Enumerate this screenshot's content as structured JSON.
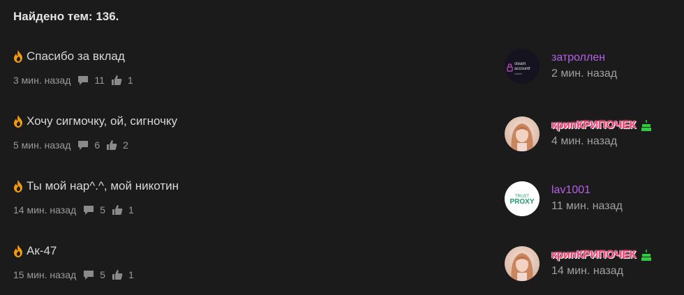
{
  "header": {
    "found_text": "Найдено тем: 136."
  },
  "threads": [
    {
      "title": "Спасибо за вклад",
      "time": "3 мин. назад",
      "replies": "11",
      "likes": "1",
      "last_user": "затроллен",
      "last_time": "2 мин. назад",
      "avatar": {
        "kind": "steam",
        "text_line1": "steam",
        "text_line2": "accountr",
        "text_line3": "market",
        "icon": "lock-icon"
      }
    },
    {
      "title": "Хочу сигмочку, ой, сигночку",
      "time": "5 мин. назад",
      "replies": "6",
      "likes": "2",
      "last_user": "крипКРИПОЧЕК",
      "last_time": "4 мин. назад",
      "avatar": {
        "kind": "photo"
      }
    },
    {
      "title": "Ты мой нар^.^, мой никотин",
      "time": "14 мин. назад",
      "replies": "5",
      "likes": "1",
      "last_user": "lav1001",
      "last_time": "11 мин. назад",
      "avatar": {
        "kind": "proxy",
        "text_line1": "TRUST",
        "text_line2": "PROXY"
      }
    },
    {
      "title": "Ак-47",
      "time": "15 мин. назад",
      "replies": "5",
      "likes": "1",
      "last_user": "крипКРИПОЧЕК",
      "last_time": "14 мин. назад",
      "avatar": {
        "kind": "photo"
      }
    }
  ],
  "icons": {
    "hot": "fire-icon",
    "replies": "comment-icon",
    "likes": "thumbs-up-icon",
    "birthday": "cake-icon"
  },
  "colors": {
    "background": "#1b1b1b",
    "fire": "#f39c12",
    "username_purple": "#b660e8",
    "username_fancy": "#ff3c64",
    "birthday_green": "#2ecc40"
  }
}
